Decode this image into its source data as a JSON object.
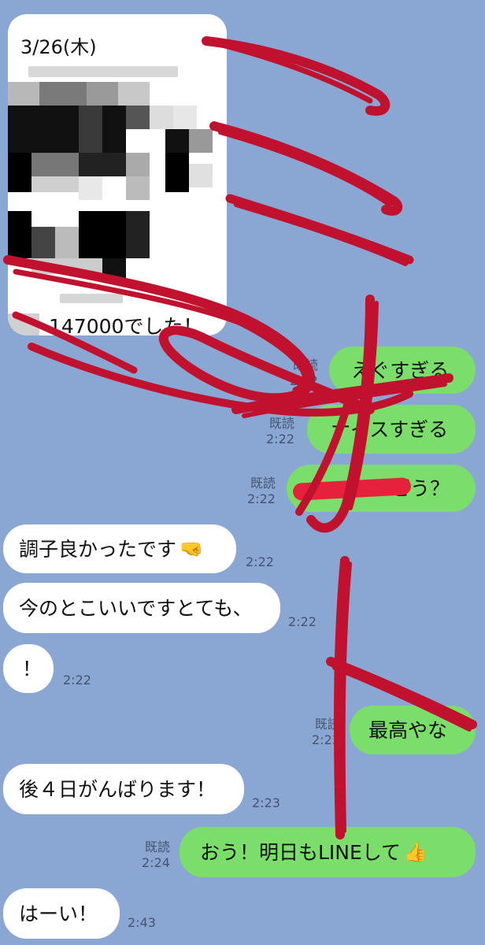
{
  "card": {
    "date": "3/26(木)",
    "message": "147000でした！"
  },
  "messages": {
    "m1": "えぐすぎる",
    "m2": "ナイスすぎる",
    "m3": "どう？",
    "m4": "調子良かったです",
    "m5": "今のとこいいですとても、",
    "m6": "！",
    "m7": "最高やな",
    "m8": "後４日がんばります！",
    "m9": "おう！明日もLINEして",
    "m10": "はーい！"
  },
  "times": {
    "t1": "2:22",
    "t2": "2:22",
    "t3": "2:22",
    "t4": "2:22",
    "t5": "2:22",
    "t6": "2:22",
    "t7": "2:23",
    "t8": "2:23",
    "t9": "2:24",
    "t10": "2:43"
  },
  "read_label": "既読",
  "icons": {
    "fist": "fist-emoji",
    "thumbs": "thumbs-up-emoji"
  },
  "colors": {
    "background": "#8aa6d3",
    "incoming": "#ffffff",
    "outgoing": "#7bde6b",
    "annotation": "#c0122e"
  }
}
